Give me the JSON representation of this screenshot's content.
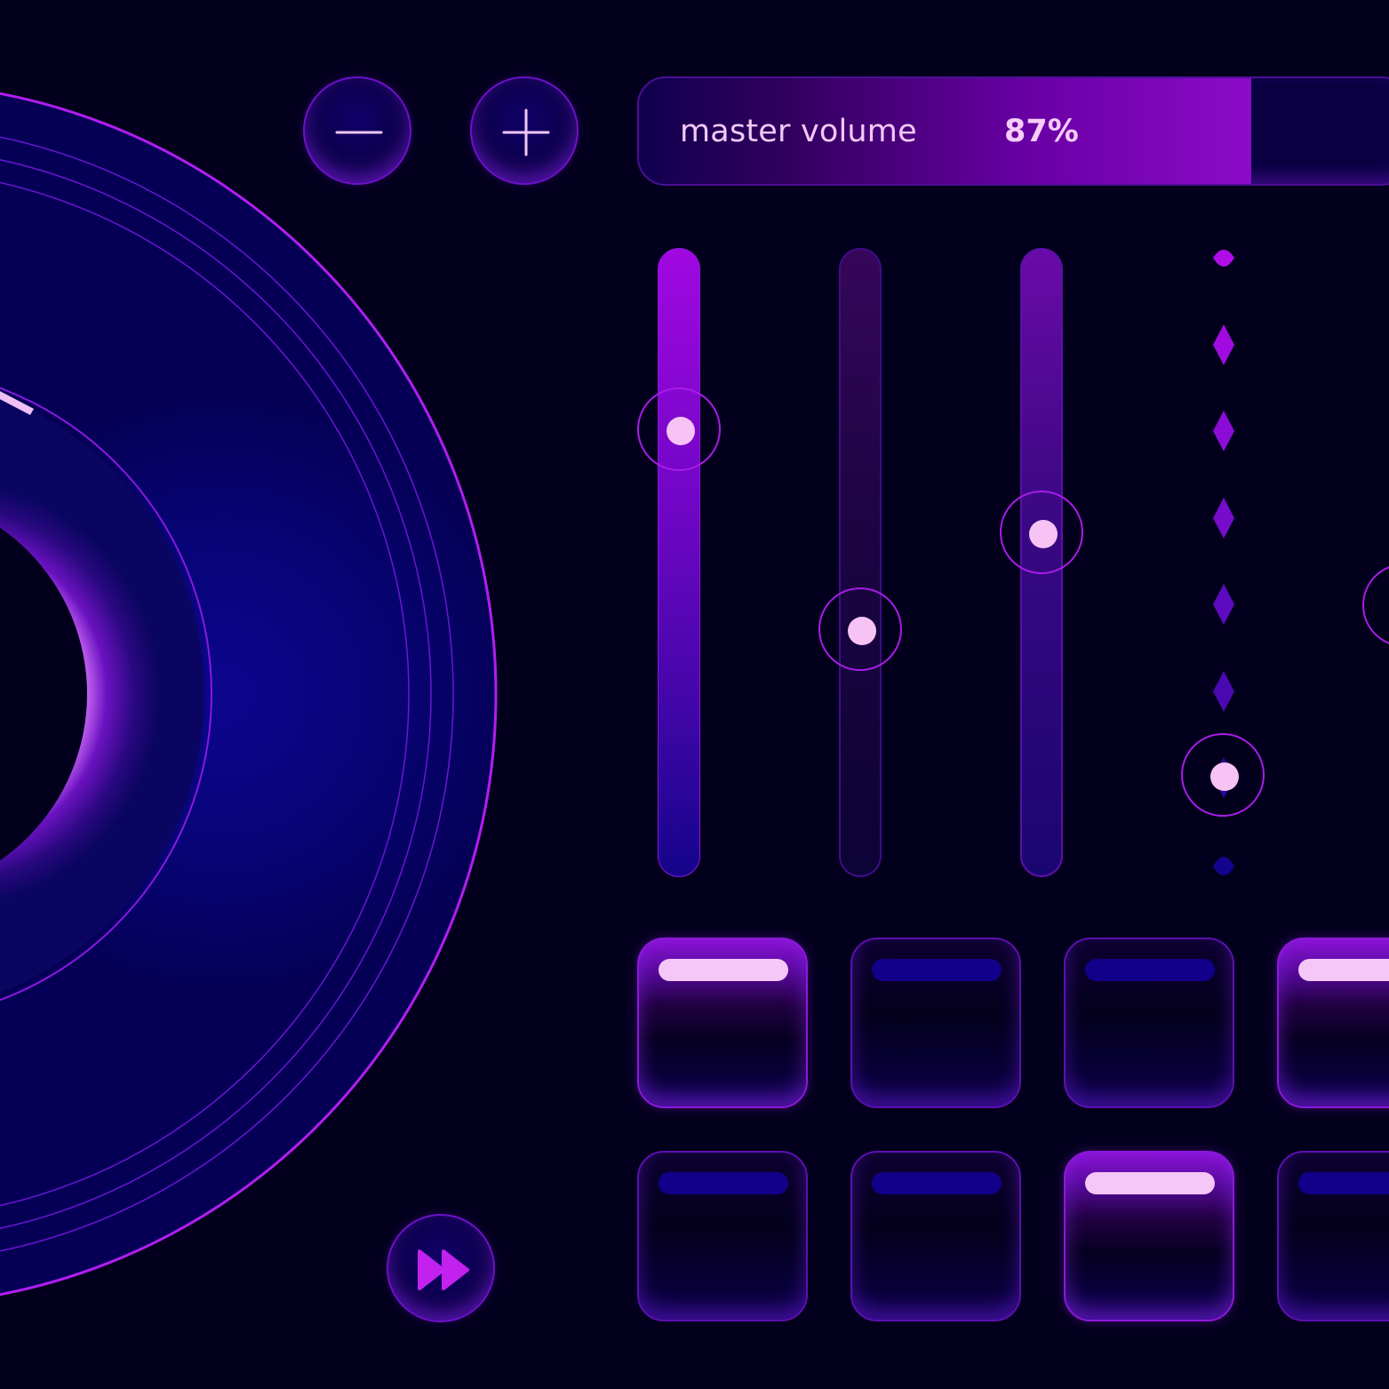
{
  "master_volume": {
    "label": "master volume",
    "value_text": "87%",
    "level": 0.87
  },
  "buttons": {
    "minus_icon": "minus-icon",
    "plus_icon": "plus-icon",
    "fast_forward_icon": "fast-forward-icon"
  },
  "faders": [
    {
      "style": "filled",
      "level": 0.72
    },
    {
      "style": "dim",
      "level": 0.39
    },
    {
      "style": "medium",
      "level": 0.55
    },
    {
      "style": "diamond-line",
      "level": 0.15
    },
    {
      "style": "partial",
      "level": 0.43
    }
  ],
  "pads": [
    {
      "row": 1,
      "active": true
    },
    {
      "row": 1,
      "active": false
    },
    {
      "row": 1,
      "active": false
    },
    {
      "row": 1,
      "active": true
    },
    {
      "row": 2,
      "active": false
    },
    {
      "row": 2,
      "active": false
    },
    {
      "row": 2,
      "active": true
    },
    {
      "row": 2,
      "active": false
    }
  ],
  "colors": {
    "background": "#03001d",
    "accent": "#a81ce8",
    "highlight": "#f5c7f8",
    "deep_blue": "#0c0a8a"
  }
}
